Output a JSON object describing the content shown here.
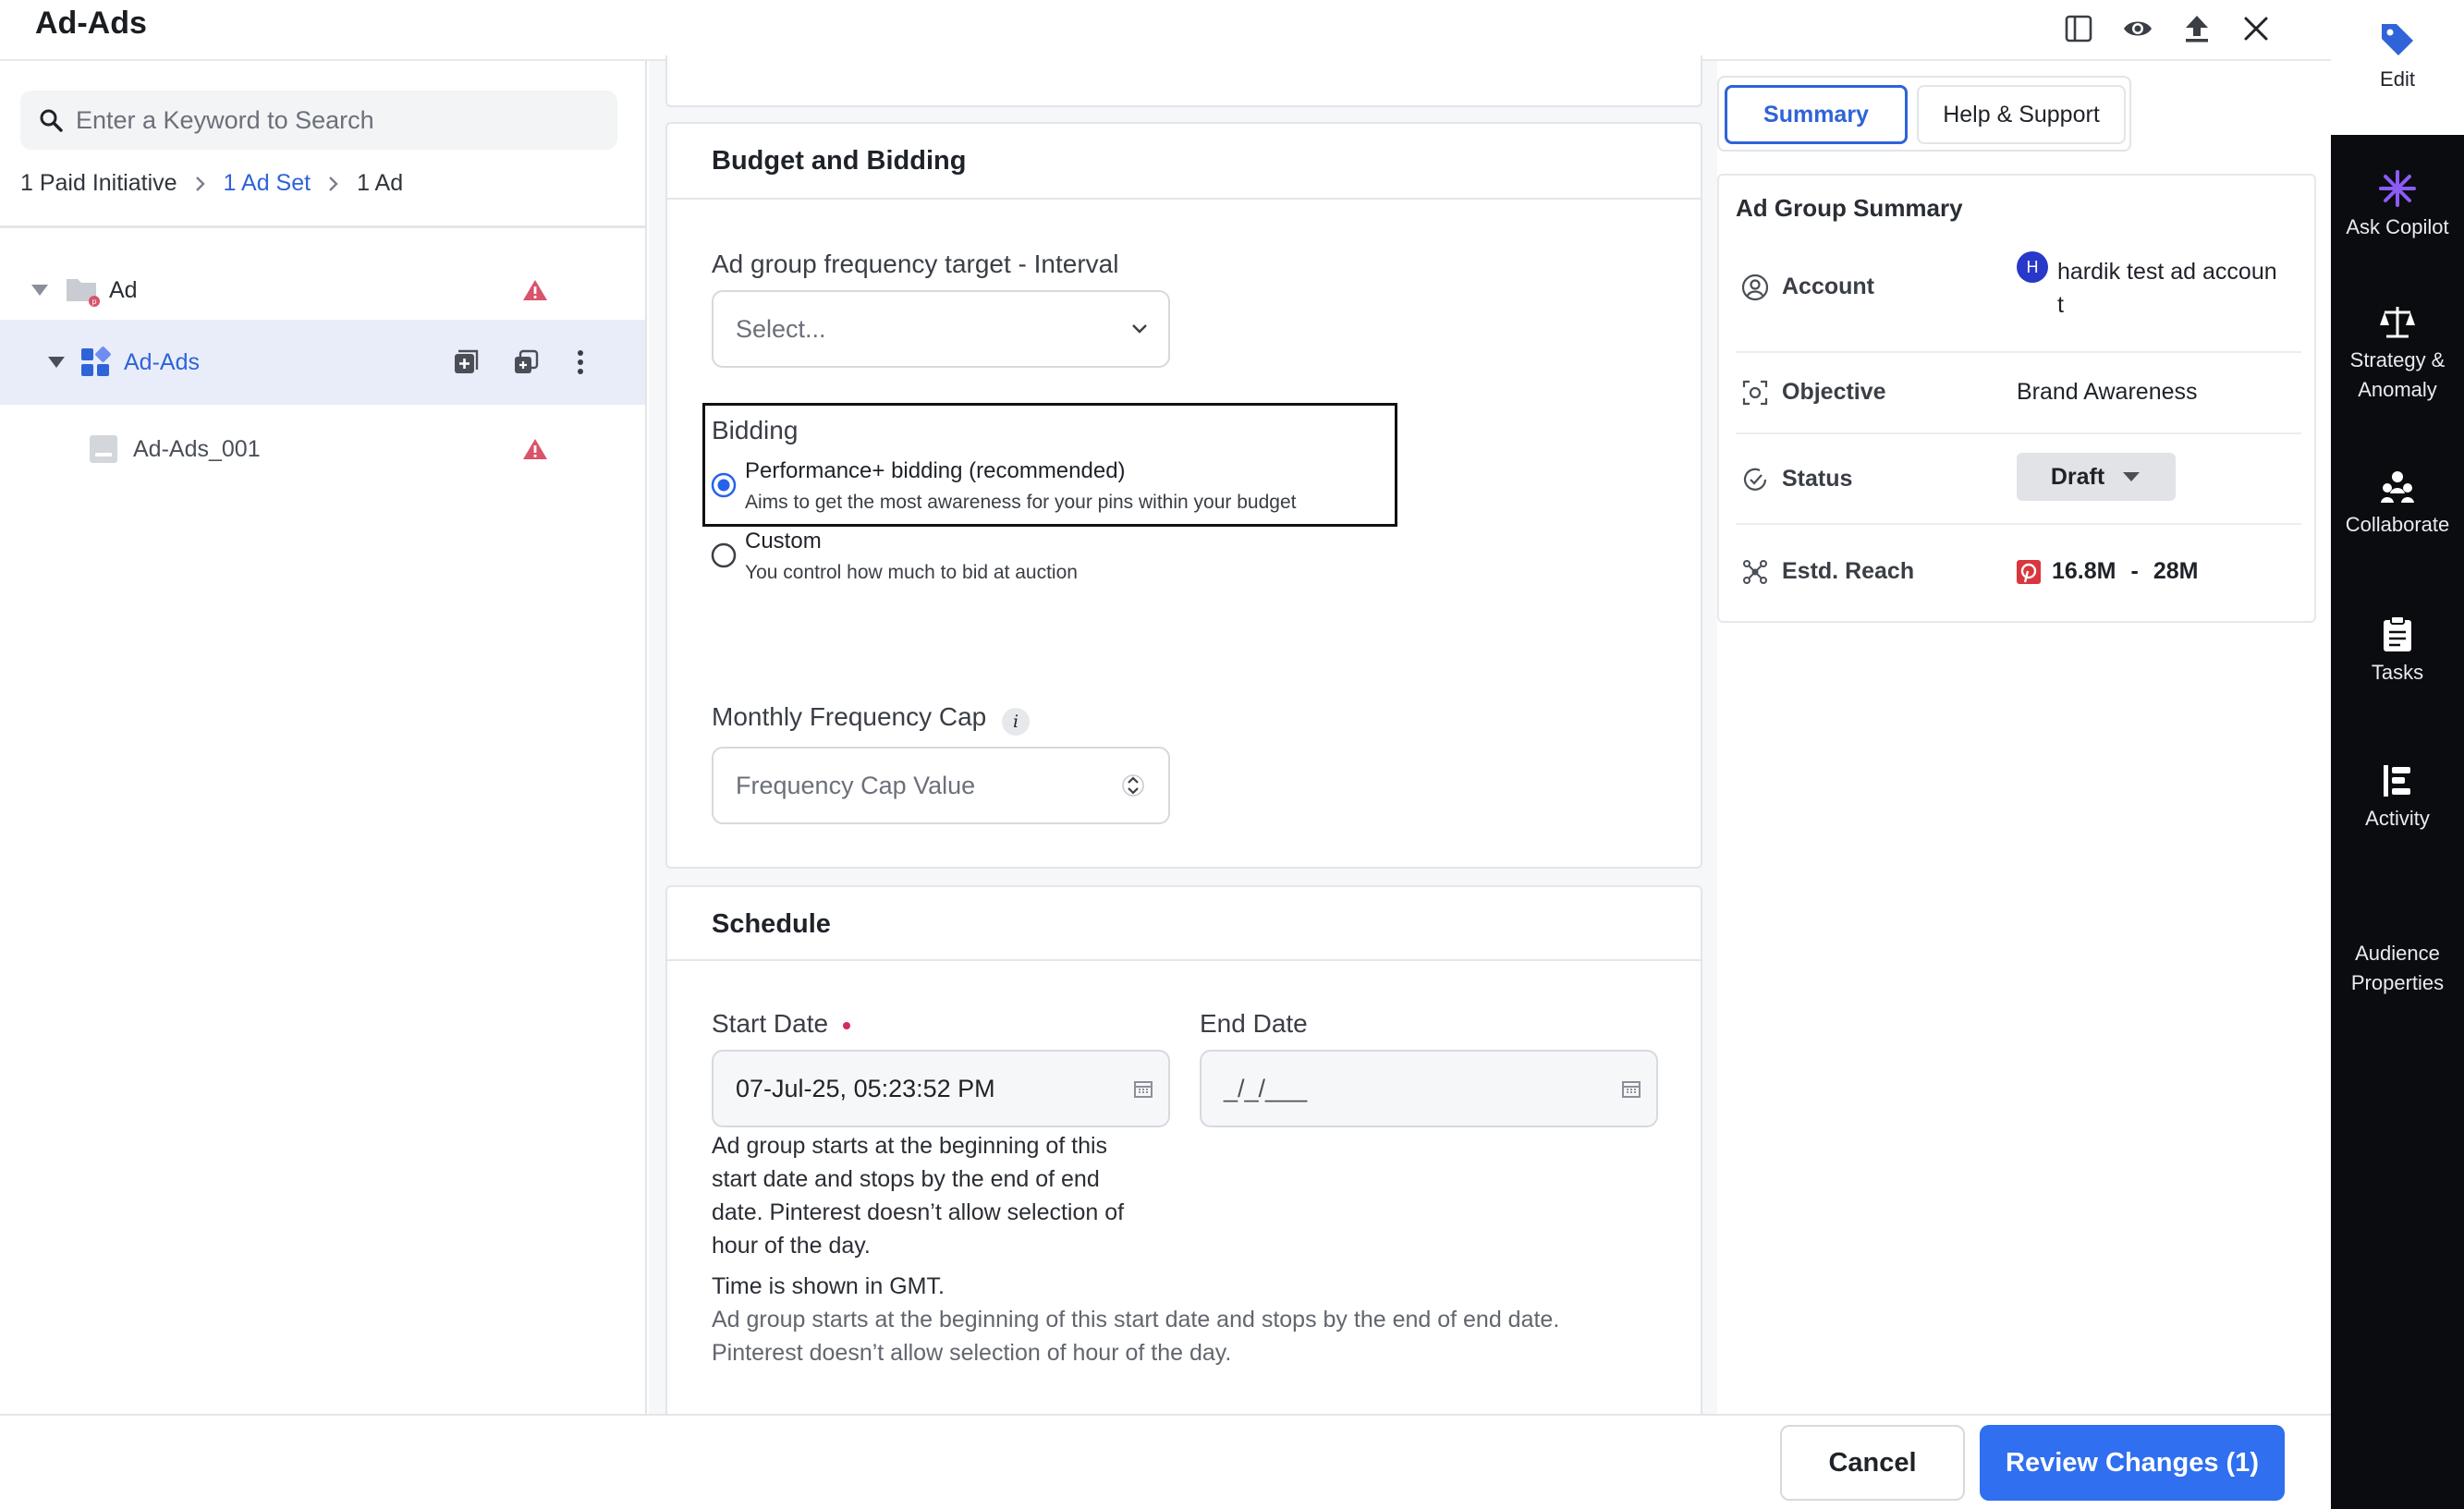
{
  "header": {
    "title": "Ad-Ads",
    "icons": [
      "panel-layout-icon",
      "eye-icon",
      "upload-icon",
      "close-icon"
    ]
  },
  "left": {
    "search_placeholder": "Enter a Keyword to Search",
    "breadcrumb": {
      "item1": "1 Paid Initiative",
      "item2": "1 Ad Set",
      "item3": "1 Ad"
    },
    "tree": {
      "root": "Ad",
      "adset": "Ad-Ads",
      "ad": "Ad-Ads_001"
    }
  },
  "budget": {
    "title": "Budget and Bidding",
    "freq_interval_label": "Ad group frequency target - Interval",
    "freq_interval_placeholder": "Select...",
    "bidding_label": "Bidding",
    "option1_title": "Performance+ bidding (recommended)",
    "option1_desc": "Aims to get the most awareness for your pins within your budget",
    "option2_title": "Custom",
    "option2_desc": "You control how much to bid at auction",
    "selected_option": "Performance+ bidding (recommended)",
    "monthly_cap_label": "Monthly Frequency Cap",
    "monthly_cap_placeholder": "Frequency Cap Value"
  },
  "schedule": {
    "title": "Schedule",
    "start_label": "Start Date",
    "start_value": "07-Jul-25, 05:23:52 PM",
    "end_label": "End Date",
    "end_placeholder": "_/_/___",
    "start_help_1": "Ad group starts at the beginning of this",
    "start_help_2": "start date and stops by the end of end",
    "start_help_3": "date. Pinterest doesn’t allow selection of",
    "start_help_4": "hour of the day.",
    "timezone_note": "Time is shown in GMT.",
    "grey_note_1": "Ad group starts at the beginning of this start date and stops by the end of end date.",
    "grey_note_2": "Pinterest doesn’t allow selection of hour of the day."
  },
  "summary": {
    "tab_summary": "Summary",
    "tab_help": "Help & Support",
    "title": "Ad Group Summary",
    "account_key": "Account",
    "account_avatar": "H",
    "account_value_1": "hardik test ad accoun",
    "account_value_2": "t",
    "objective_key": "Objective",
    "objective_value": "Brand Awareness",
    "status_key": "Status",
    "status_value": "Draft",
    "reach_key": "Estd. Reach",
    "reach_low": "16.8M",
    "reach_sep": "-",
    "reach_high": "28M"
  },
  "rail": {
    "edit": "Edit",
    "copilot": "Ask Copilot",
    "strategy_1": "Strategy &",
    "strategy_2": "Anomaly",
    "collaborate": "Collaborate",
    "tasks": "Tasks",
    "activity": "Activity",
    "audience_1": "Audience",
    "audience_2": "Properties"
  },
  "footer": {
    "cancel": "Cancel",
    "review": "Review Changes (1)"
  },
  "colors": {
    "accent": "#2563eb",
    "primary_button": "#2f6ff0",
    "warning": "#d9536b",
    "rail_bg": "#0b0c10",
    "link": "#2f63d8"
  }
}
